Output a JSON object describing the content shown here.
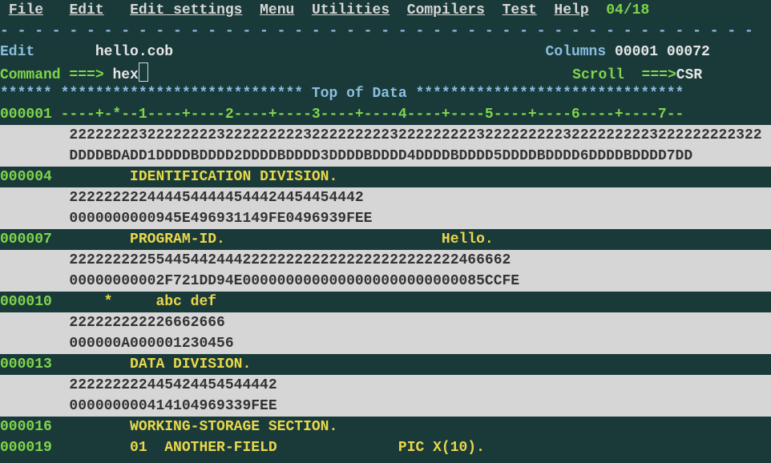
{
  "menu": {
    "items": [
      "File",
      "Edit",
      "Edit_settings",
      "Menu",
      "Utilities",
      "Compilers",
      "Test",
      "Help"
    ],
    "right": "04/18"
  },
  "divider": "- - - - - - - - - - - - - - - - - - - - - - - - - - - - - - - - - - - - - - - - - - - -",
  "header": {
    "mode": "Edit",
    "file": "hello.cob",
    "cols_label": "Columns",
    "cols_from": "00001",
    "cols_to": "00072"
  },
  "cmd": {
    "label": "Command ===> ",
    "value": "hex",
    "scroll_label": "Scroll  ===>",
    "scroll_value": "CSR"
  },
  "topdata": "****** **************************** Top of Data *******************************",
  "lines": {
    "l1_num": "000001",
    "l1_src": " ----+-*--1----+----2----+----3----+----4----+----5----+----6----+----7--",
    "l1_hexA": "22222222322222222322222222232222222223222222222322222222232222222223222222222322",
    "l1_hexB": "DDDDBDADD1DDDDBDDDD2DDDDBDDDD3DDDDBDDDD4DDDDBDDDD5DDDDBDDDD6DDDDBDDDD7DD",
    "l4_num": "000004",
    "l4_src": "        IDENTIFICATION DIVISION.",
    "l4_hexA": "2222222224444544444544424454454442",
    "l4_hexB": "0000000000945E496931149FE0496939FEE",
    "l7_num": "000007",
    "l7_src": "        PROGRAM-ID.                         Hello.",
    "l7_hexA": "222222222554454424442222222222222222222222222466662",
    "l7_hexB": "00000000002F721DD94E0000000000000000000000000085CCFE",
    "l10_num": "000010",
    "l10_src": "     *     abc def",
    "l10_hexA": "222222222226662666",
    "l10_hexB": "000000A000001230456",
    "l13_num": "000013",
    "l13_src": "        DATA DIVISION.",
    "l13_hexA": "222222222445424454544442",
    "l13_hexB": "000000000414104969339FEE",
    "l16_num": "000016",
    "l16_src": "        WORKING-STORAGE SECTION.",
    "l19_num": "000019",
    "l19_src": "        01  ANOTHER-FIELD              PIC X(10)."
  }
}
